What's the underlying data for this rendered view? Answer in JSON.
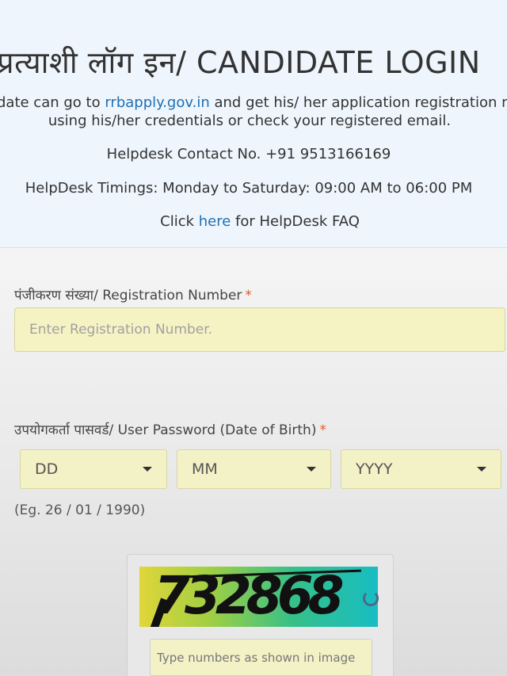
{
  "header": {
    "title": "प्रत्याशी लॉग इन/ CANDIDATE LOGIN",
    "desc_line1_prefix": "date can go to ",
    "desc_link": "rrbapply.gov.in",
    "desc_line1_suffix": " and get his/ her application registration n",
    "desc_line2": "using his/her credentials or check your registered email.",
    "helpdesk_contact": "Helpdesk Contact No. +91 9513166169",
    "helpdesk_timings": "HelpDesk Timings: Monday to Saturday: 09:00 AM to 06:00 PM",
    "faq_prefix": "Click ",
    "faq_link": "here",
    "faq_suffix": " for HelpDesk FAQ"
  },
  "form": {
    "registration": {
      "label": "पंजीकरण संख्या/ Registration Number",
      "required": "*",
      "placeholder": "Enter Registration Number.",
      "value": ""
    },
    "password": {
      "label": "उपयोगकर्ता पासवर्ड/ User Password (Date of Birth)",
      "required": "*",
      "day": "DD",
      "month": "MM",
      "year": "YYYY",
      "hint": "(Eg. 26 / 01 / 1990)"
    },
    "captcha": {
      "code": "732868",
      "placeholder": "Type numbers as shown in image",
      "value": ""
    }
  },
  "icons": {
    "select_caret": "caret-down-icon",
    "refresh": "refresh-icon"
  },
  "colors": {
    "header_bg": "#eef5fc",
    "link": "#1f6fb5",
    "required": "#e05a2b",
    "input_bg": "#f5f3c4"
  }
}
